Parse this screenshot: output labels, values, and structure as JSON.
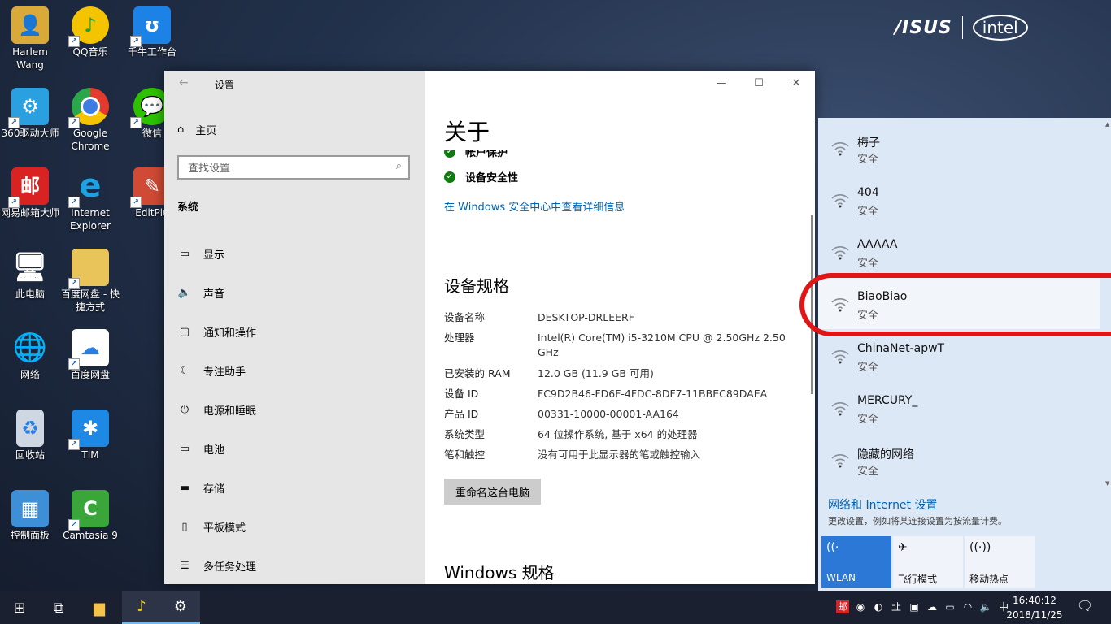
{
  "desktop": {
    "icons": [
      {
        "label": "Harlem Wang",
        "glyph": "user-folder-icon",
        "color": "#d9a93a"
      },
      {
        "label": "QQ音乐",
        "glyph": "qq-music-icon",
        "color": "#f5c400"
      },
      {
        "label": "千牛工作台",
        "glyph": "qianniu-icon",
        "color": "#1d82e6"
      },
      {
        "label": "360驱动大师",
        "glyph": "gear-icon",
        "color": "#2aa0e0"
      },
      {
        "label": "Google Chrome",
        "glyph": "chrome-icon",
        "color": "#e23b2e"
      },
      {
        "label": "微信",
        "glyph": "wechat-icon",
        "color": "#2dc100"
      },
      {
        "label": "网易邮箱大师",
        "glyph": "mail-master-icon",
        "color": "#d92323"
      },
      {
        "label": "Internet Explorer",
        "glyph": "ie-icon",
        "color": "#1ea0e2"
      },
      {
        "label": "EditPlu",
        "glyph": "editplus-icon",
        "color": "#d04a35"
      },
      {
        "label": "此电脑",
        "glyph": "computer-icon",
        "color": "#3b8fd6"
      },
      {
        "label": "百度网盘 - 快捷方式",
        "glyph": "folder-icon",
        "color": "#e9c45a"
      },
      {
        "label": "网络",
        "glyph": "network-icon",
        "color": "#3b8fd6"
      },
      {
        "label": "百度网盘",
        "glyph": "baidu-netdisk-icon",
        "color": "#ffffff"
      },
      {
        "label": "回收站",
        "glyph": "recycle-bin-icon",
        "color": "#cfd8e2"
      },
      {
        "label": "TIM",
        "glyph": "tim-icon",
        "color": "#1e88e5"
      },
      {
        "label": "控制面板",
        "glyph": "control-panel-icon",
        "color": "#3d8fd8"
      },
      {
        "label": "Camtasia 9",
        "glyph": "camtasia-icon",
        "color": "#3aa63a"
      }
    ],
    "brand_asus": "/ISUS",
    "brand_intel": "intel"
  },
  "settings": {
    "title": "设置",
    "home": "主页",
    "search_placeholder": "查找设置",
    "section": "系统",
    "nav": [
      {
        "label": "显示",
        "icon": "display-icon"
      },
      {
        "label": "声音",
        "icon": "speaker-icon"
      },
      {
        "label": "通知和操作",
        "icon": "notification-icon"
      },
      {
        "label": "专注助手",
        "icon": "moon-icon"
      },
      {
        "label": "电源和睡眠",
        "icon": "power-icon"
      },
      {
        "label": "电池",
        "icon": "battery-icon"
      },
      {
        "label": "存储",
        "icon": "storage-icon"
      },
      {
        "label": "平板模式",
        "icon": "tablet-icon"
      },
      {
        "label": "多任务处理",
        "icon": "multitask-icon"
      }
    ],
    "page_title": "关于",
    "security_items": [
      "帐户保护",
      "设备安全性"
    ],
    "security_link": "在 Windows 安全中心中查看详细信息",
    "spec_heading": "设备规格",
    "specs": [
      {
        "k": "设备名称",
        "v": "DESKTOP-DRLEERF"
      },
      {
        "k": "处理器",
        "v": "Intel(R) Core(TM) i5-3210M CPU @ 2.50GHz   2.50 GHz"
      },
      {
        "k": "已安装的 RAM",
        "v": "12.0 GB (11.9 GB 可用)"
      },
      {
        "k": "设备 ID",
        "v": "FC9D2B46-FD6F-4FDC-8DF7-11BBEC89DAEA"
      },
      {
        "k": "产品 ID",
        "v": "00331-10000-00001-AA164"
      },
      {
        "k": "系统类型",
        "v": "64 位操作系统, 基于 x64 的处理器"
      },
      {
        "k": "笔和触控",
        "v": "没有可用于此显示器的笔或触控输入"
      }
    ],
    "rename_button": "重命名这台电脑",
    "windows_heading": "Windows 规格"
  },
  "network": {
    "networks": [
      {
        "name": "梅子",
        "status": "安全"
      },
      {
        "name": "404",
        "status": "安全"
      },
      {
        "name": "AAAAA",
        "status": "安全"
      },
      {
        "name": "BiaoBiao",
        "status": "安全"
      },
      {
        "name": "ChinaNet-apwT",
        "status": "安全"
      },
      {
        "name": "MERCURY_",
        "status": "安全"
      },
      {
        "name": "隐藏的网络",
        "status": "安全"
      }
    ],
    "settings_link": "网络和 Internet 设置",
    "settings_sub": "更改设置，例如将某连接设置为按流量计费。",
    "tiles": [
      {
        "label": "WLAN",
        "icon": "wifi-icon",
        "active": true
      },
      {
        "label": "飞行模式",
        "icon": "airplane-icon",
        "active": false
      },
      {
        "label": "移动热点",
        "icon": "hotspot-icon",
        "active": false
      }
    ],
    "active_tile_color": "#2b78d7"
  },
  "taskbar": {
    "time": "16:40:12",
    "date": "2018/11/25"
  }
}
